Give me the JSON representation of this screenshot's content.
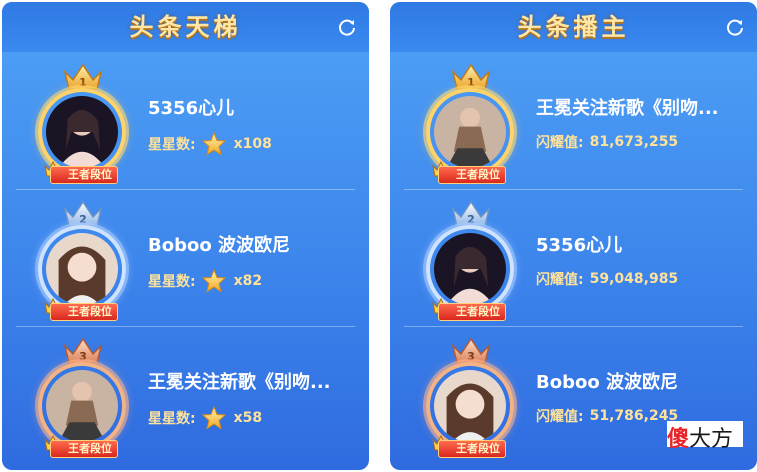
{
  "ladder": {
    "title": "头条天梯",
    "stat_label": "星星数:",
    "rows": [
      {
        "rank": "1",
        "name": "5356心儿",
        "count": "x108",
        "badge": "王者段位"
      },
      {
        "rank": "2",
        "name": "Boboo 波波欧尼",
        "count": "x82",
        "badge": "王者段位"
      },
      {
        "rank": "3",
        "name": "王冕关注新歌《别吻...",
        "count": "x58",
        "badge": "王者段位"
      }
    ]
  },
  "hosts": {
    "title": "头条播主",
    "stat_label": "闪耀值:",
    "rows": [
      {
        "rank": "1",
        "name": "王冕关注新歌《别吻...",
        "value": "81,673,255",
        "badge": "王者段位"
      },
      {
        "rank": "2",
        "name": "5356心儿",
        "value": "59,048,985",
        "badge": "王者段位"
      },
      {
        "rank": "3",
        "name": "Boboo 波波欧尼",
        "value": "51,786,245",
        "badge": "王者段位"
      }
    ]
  },
  "watermark": {
    "red": "傻",
    "black": "大方"
  },
  "colors": {
    "gold": "#ffd36a",
    "silver": "#cfe3ff",
    "bronze": "#f4b385",
    "title": "#ffe7a6"
  }
}
